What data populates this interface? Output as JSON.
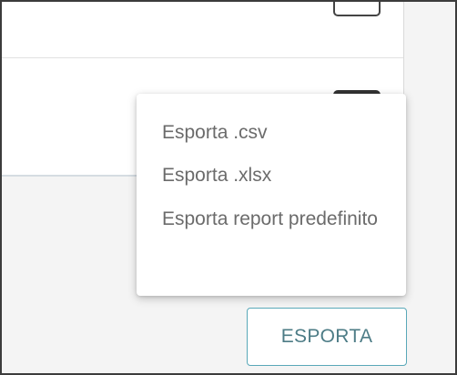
{
  "menu": {
    "items": [
      {
        "label": "Esporta .csv"
      },
      {
        "label": "Esporta .xlsx"
      },
      {
        "label": "Esporta report predefinito"
      }
    ]
  },
  "export_button": {
    "label": "ESPORTA"
  },
  "colors": {
    "accent_border": "#59a8b8",
    "button_text": "#4d7c86",
    "menu_text": "#6b6b6b",
    "background": "#f4f4f4"
  }
}
